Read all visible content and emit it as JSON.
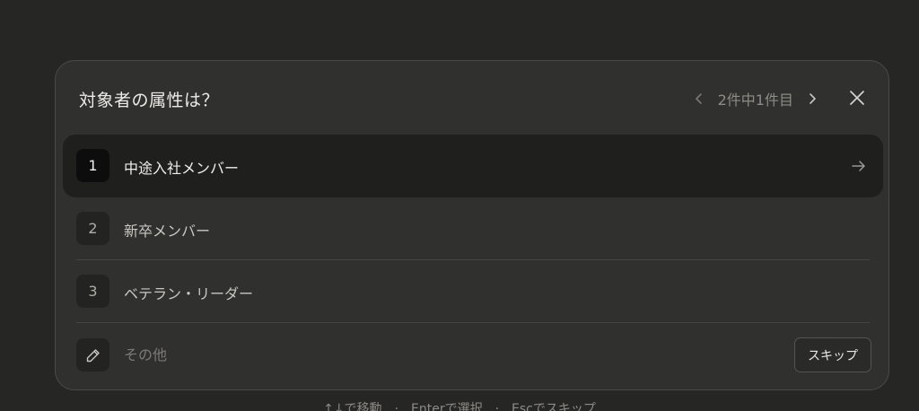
{
  "dialog": {
    "title": "対象者の属性は？",
    "pager": {
      "text": "2件中1件目",
      "prev_icon": "chevron-left-icon",
      "next_icon": "chevron-right-icon"
    },
    "close_icon": "close-icon"
  },
  "options": [
    {
      "number": "1",
      "label": "中途入社メンバー",
      "selected": true,
      "icon": "arrow-right-icon"
    },
    {
      "number": "2",
      "label": "新卒メンバー",
      "selected": false
    },
    {
      "number": "3",
      "label": "ベテラン・リーダー",
      "selected": false
    }
  ],
  "other": {
    "icon": "pencil-icon",
    "placeholder": "その他",
    "value": "",
    "skip_label": "スキップ"
  },
  "hints": {
    "move": "↑↓で移動",
    "select": "Enterで選択",
    "skip": "Escでスキップ",
    "separator": "·"
  },
  "colors": {
    "background": "#262624",
    "dialog": "#30302e",
    "selected_row": "#1f1f1e",
    "muted_text": "#8d8b86"
  }
}
